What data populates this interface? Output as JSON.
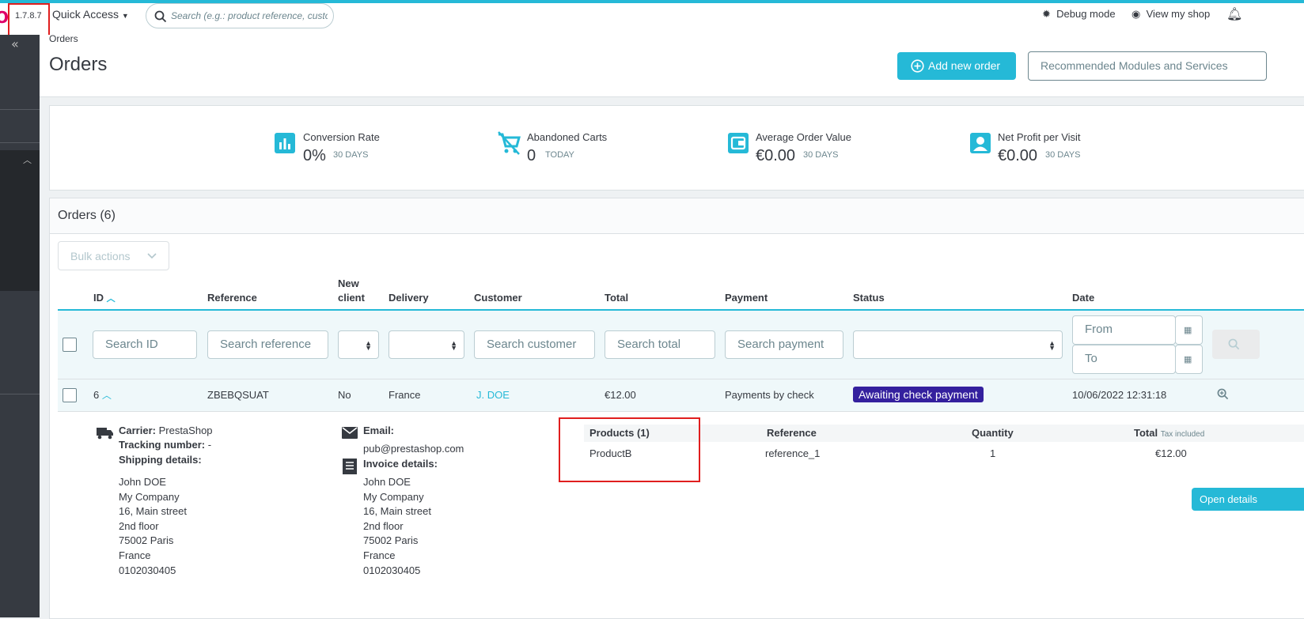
{
  "topbar": {
    "version": "1.7.8.7",
    "quick_access": "Quick Access",
    "search_placeholder": "Search (e.g.: product reference, custon",
    "debug_mode": "Debug mode",
    "view_shop": "View my shop"
  },
  "header": {
    "breadcrumb": "Orders",
    "title": "Orders",
    "add_new_order": "Add new order",
    "recommended": "Recommended Modules and Services"
  },
  "kpis": [
    {
      "label": "Conversion Rate",
      "value": "0%",
      "period": "30 DAYS",
      "icon": "bar-chart-icon"
    },
    {
      "label": "Abandoned Carts",
      "value": "0",
      "period": "TODAY",
      "icon": "remove-cart-icon"
    },
    {
      "label": "Average Order Value",
      "value": "€0.00",
      "period": "30 DAYS",
      "icon": "wallet-icon"
    },
    {
      "label": "Net Profit per Visit",
      "value": "€0.00",
      "period": "30 DAYS",
      "icon": "user-icon"
    }
  ],
  "orders_panel": {
    "title": "Orders (6)",
    "bulk_actions": "Bulk actions"
  },
  "table": {
    "headers": {
      "id": "ID",
      "reference": "Reference",
      "new_client_1": "New",
      "new_client_2": "client",
      "delivery": "Delivery",
      "customer": "Customer",
      "total": "Total",
      "payment": "Payment",
      "status": "Status",
      "date": "Date"
    },
    "filters": {
      "id": "Search ID",
      "reference": "Search reference",
      "customer": "Search customer",
      "total": "Search total",
      "payment": "Search payment",
      "date_from": "From",
      "date_to": "To"
    },
    "row": {
      "id": "6",
      "reference": "ZBEBQSUAT",
      "new_client": "No",
      "delivery": "France",
      "customer": "J. DOE",
      "total": "€12.00",
      "payment": "Payments by check",
      "status": "Awaiting check payment",
      "date": "10/06/2022 12:31:18"
    }
  },
  "details": {
    "carrier_label": "Carrier:",
    "carrier_value": "PrestaShop",
    "tracking_label": "Tracking number:",
    "tracking_value": "-",
    "shipping_label": "Shipping details:",
    "shipping_address": [
      "John DOE",
      "My Company",
      "16, Main street",
      "2nd floor",
      "75002 Paris",
      "France",
      "0102030405"
    ],
    "email_label": "Email:",
    "email_value": "pub@prestashop.com",
    "invoice_label": "Invoice details:",
    "invoice_address": [
      "John DOE",
      "My Company",
      "16, Main street",
      "2nd floor",
      "75002 Paris",
      "France",
      "0102030405"
    ],
    "products_header": "Products (1)",
    "reference_header": "Reference",
    "quantity_header": "Quantity",
    "total_header": "Total",
    "tax_included": "Tax included",
    "product_name": "ProductB",
    "product_reference": "reference_1",
    "product_quantity": "1",
    "product_total": "€12.00",
    "open_details": "Open details"
  },
  "colors": {
    "accent": "#25b9d7",
    "status_badge": "#34209e",
    "sidebar": "#363a41",
    "highlight_box": "#e01e1e"
  }
}
